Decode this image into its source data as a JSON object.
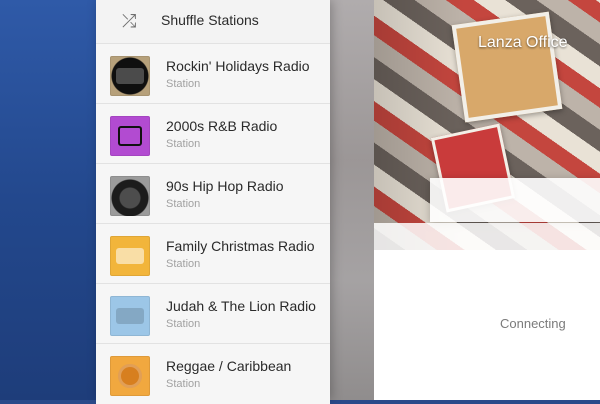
{
  "sidebar": {
    "shuffle_label": "Shuffle Stations",
    "items": [
      {
        "title": "Rockin' Holidays Radio",
        "subtitle": "Station",
        "thumb_icon": "rockin-holidays-thumb"
      },
      {
        "title": "2000s R&B Radio",
        "subtitle": "Station",
        "thumb_icon": "2000s-rnb-thumb"
      },
      {
        "title": "90s Hip Hop Radio",
        "subtitle": "Station",
        "thumb_icon": "90s-hip-hop-thumb"
      },
      {
        "title": "Family Christmas Radio",
        "subtitle": "Station",
        "thumb_icon": "family-christmas-thumb"
      },
      {
        "title": "Judah & The Lion Radio",
        "subtitle": "Station",
        "thumb_icon": "judah-lion-thumb"
      },
      {
        "title": "Reggae / Caribbean",
        "subtitle": "Station",
        "thumb_icon": "reggae-caribbean-thumb"
      }
    ]
  },
  "now_playing": {
    "room_title": "Lanza Office",
    "status": "Connecting"
  }
}
